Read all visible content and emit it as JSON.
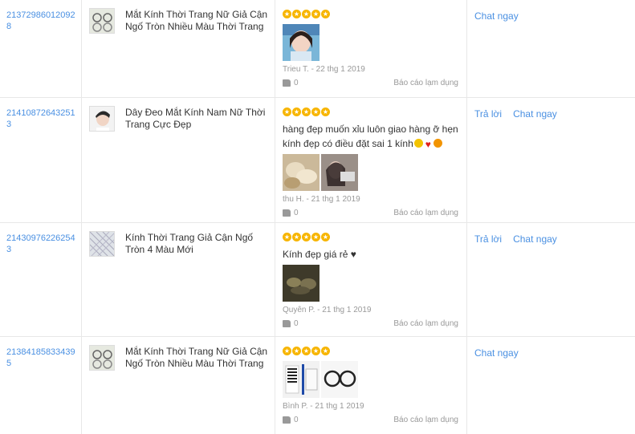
{
  "rows": [
    {
      "order_id": "213729860120928",
      "product_name": "Mắt Kính Thời Trang Nữ Giả Cận Ngố Tròn Nhiều Màu Thời Trang",
      "review_text": "",
      "reviewer": "Trieu T. - 22 thg 1 2019",
      "likes": "0",
      "report_label": "Báo cáo lạm dụng",
      "reply_label": "",
      "chat_label": "Chat ngay"
    },
    {
      "order_id": "214108726432513",
      "product_name": "Dây Đeo Mắt Kính Nam Nữ Thời Trang Cực Đẹp",
      "review_text": "hàng đẹp muốn xỉu luôn giao hàng ỡ hẹn kính đẹp có điều đặt sai 1 kính",
      "reviewer": "thu H. - 21 thg 1 2019",
      "likes": "0",
      "report_label": "Báo cáo lạm dụng",
      "reply_label": "Trả lời",
      "chat_label": "Chat ngay"
    },
    {
      "order_id": "214309762262543",
      "product_name": "Kính Thời Trang Giả Cận Ngố Tròn 4 Màu Mới",
      "review_text": "Kính đẹp giá rẻ ♥",
      "reviewer": "Quyên P. - 21 thg 1 2019",
      "likes": "0",
      "report_label": "Báo cáo lạm dụng",
      "reply_label": "Trả lời",
      "chat_label": "Chat ngay"
    },
    {
      "order_id": "213841858334395",
      "product_name": "Mắt Kính Thời Trang Nữ Giả Cận Ngố Tròn Nhiều Màu Thời Trang",
      "review_text": "",
      "reviewer": "Bình P. - 21 thg 1 2019",
      "likes": "0",
      "report_label": "Báo cáo lạm dụng",
      "reply_label": "",
      "chat_label": "Chat ngay"
    }
  ]
}
